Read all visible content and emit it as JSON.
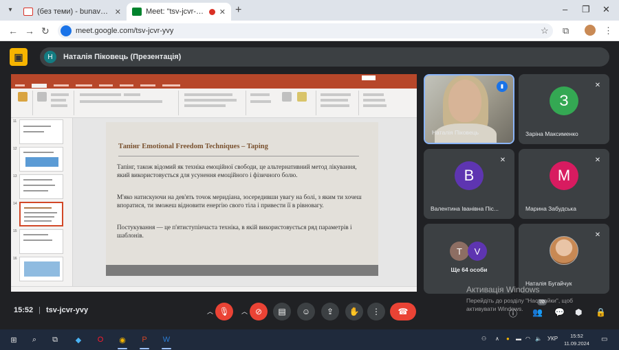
{
  "browser": {
    "tabs": [
      {
        "title": "(без теми) - bunava17@gmail.c",
        "icon": "gmail-icon"
      },
      {
        "title": "Meet: \"tsv-jcvr-yvy\"",
        "icon": "meet-icon",
        "recording": true
      }
    ],
    "url": "meet.google.com/tsv-jcvr-yvy"
  },
  "meet": {
    "presenter_initial": "Н",
    "presenter_label": "Наталія Піковець (Презентація)",
    "time": "15:52",
    "code": "tsv-jcvr-yvy",
    "participants_badge": "70"
  },
  "slide": {
    "title_bold": "Тапінг",
    "title_rest": " Emotional Freedom Techniques – Taping",
    "p1": "Тапінг, також відомий як техніка емоційної свободи, це альтернативний метод лікування, який використовується для усунення емоційного і фізичного болю.",
    "p2": "М'яко натискуючи на дев'ять точок меридіана, зосередивши увагу на болі, з яким ти хочеш впоратися, ти зможеш відновити енергію свого тіла і привести її в рівновагу.",
    "p3": "Постукування — це п'ятиступінчаста техніка, в якій використовується ряд параметрів і шаблонів.",
    "thumb_numbers": [
      "11",
      "12",
      "13",
      "14",
      "15",
      "16"
    ]
  },
  "tiles": [
    {
      "name": "Наталія Піковець",
      "type": "camera"
    },
    {
      "name": "Заріна Максименко",
      "initial": "З",
      "color": "#34a853"
    },
    {
      "name": "Валентина Іванівна Піс...",
      "initial": "В",
      "color": "#5e35b1"
    },
    {
      "name": "Марина Забудська",
      "initial": "М",
      "color": "#d81b60"
    },
    {
      "name": "Ще 64 особи",
      "initials": [
        "Т",
        "V"
      ],
      "colors": [
        "#8d6e63",
        "#5e35b1"
      ]
    },
    {
      "name": "Наталія Бугайчук",
      "type": "photo"
    }
  ],
  "watermark": {
    "line1": "Активація Windows",
    "line2": "Перейдіть до розділу \"Настройки\", щоб активувати Windows."
  },
  "taskbar": {
    "lang": "УКР",
    "time": "15:52",
    "date": "11.09.2024"
  }
}
